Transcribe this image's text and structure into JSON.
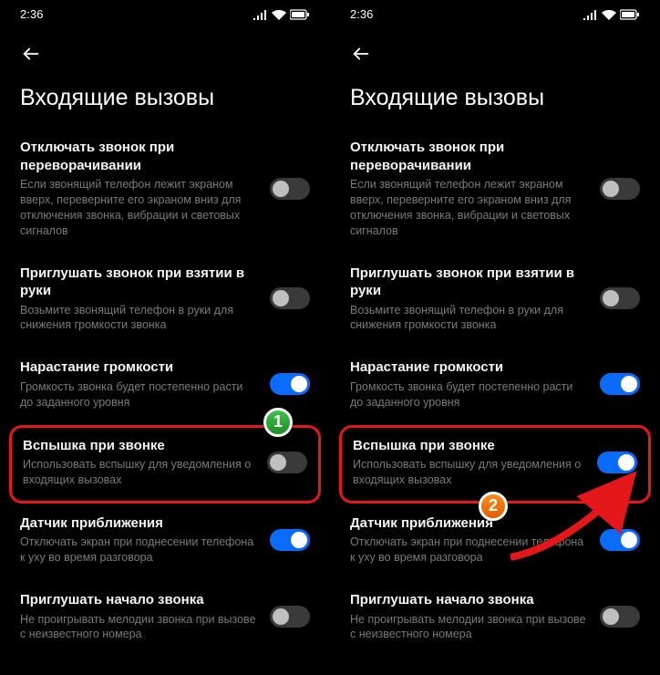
{
  "statusbar": {
    "time": "2:36"
  },
  "pageTitle": "Входящие вызовы",
  "settings": [
    {
      "title": "Отключать звонок при переворачивании",
      "desc": "Если звонящий телефон лежит экраном вверх, переверните его экраном вниз для отключения звонка, вибрации и световых сигналов",
      "state_left": "off",
      "state_right": "off"
    },
    {
      "title": "Приглушать звонок при взятии в руки",
      "desc": "Возьмите звонящий телефон в руки для снижения громкости звонка",
      "state_left": "off",
      "state_right": "off"
    },
    {
      "title": "Нарастание громкости",
      "desc": "Громкость звонка будет постепенно расти до заданного уровня",
      "state_left": "on",
      "state_right": "on"
    },
    {
      "title": "Вспышка при звонке",
      "desc": "Использовать вспышку для уведомления о входящих вызовах",
      "state_left": "off",
      "state_right": "on",
      "highlight": true
    },
    {
      "title": "Датчик приближения",
      "desc": "Отключать экран при поднесении телефона к уху во время разговора",
      "state_left": "on",
      "state_right": "on"
    },
    {
      "title": "Приглушать начало звонка",
      "desc": "Не проигрывать мелодии звонка при вызове с неизвестного номера",
      "state_left": "off",
      "state_right": "off"
    }
  ],
  "badges": {
    "one": "1",
    "two": "2"
  }
}
